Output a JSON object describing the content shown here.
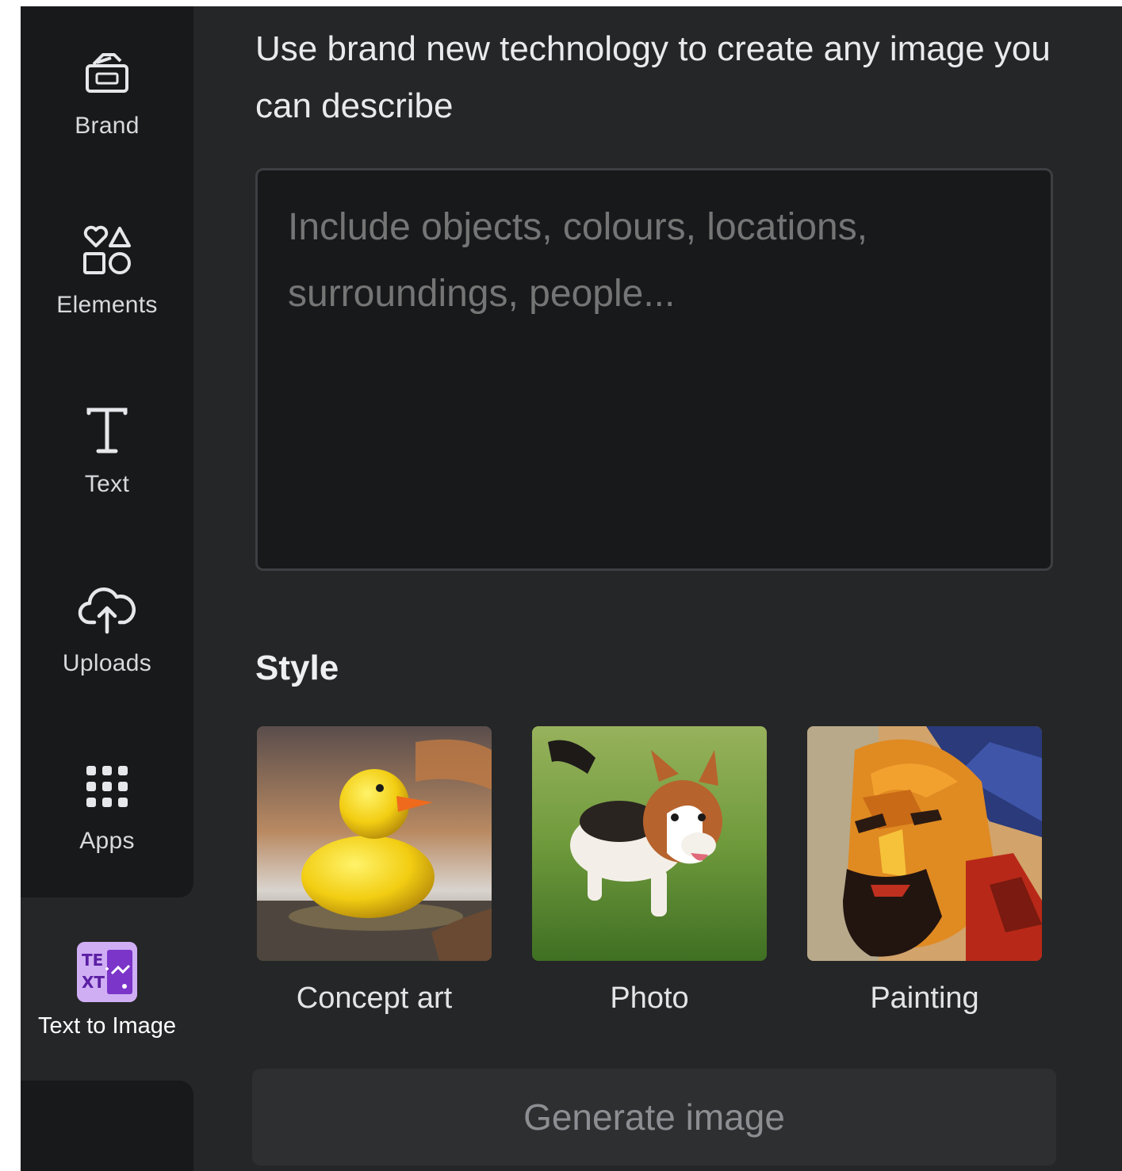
{
  "sidebar": {
    "items": [
      {
        "label": "Brand",
        "icon": "brand-kit-icon"
      },
      {
        "label": "Elements",
        "icon": "shapes-icon"
      },
      {
        "label": "Text",
        "icon": "text-icon"
      },
      {
        "label": "Uploads",
        "icon": "cloud-upload-icon"
      },
      {
        "label": "Apps",
        "icon": "apps-grid-icon"
      },
      {
        "label": "Text to Image",
        "icon": "text-to-image-icon",
        "active": true
      }
    ]
  },
  "main": {
    "intro": "Use brand new technology to create any image you can describe",
    "prompt_placeholder": "Include objects, colours, locations, surroundings, people...",
    "style_title": "Style",
    "styles": [
      {
        "label": "Concept art",
        "image": "rubber-duck-thumbnail"
      },
      {
        "label": "Photo",
        "image": "corgi-puppy-thumbnail"
      },
      {
        "label": "Painting",
        "image": "portrait-painting-thumbnail"
      }
    ],
    "generate_label": "Generate image"
  },
  "colors": {
    "panel_bg": "#252627",
    "rail_bg": "#18191b",
    "input_bg": "#18191b",
    "button_disabled_bg": "#2e2f31",
    "text_to_image_accent": "#c9a7f0"
  }
}
